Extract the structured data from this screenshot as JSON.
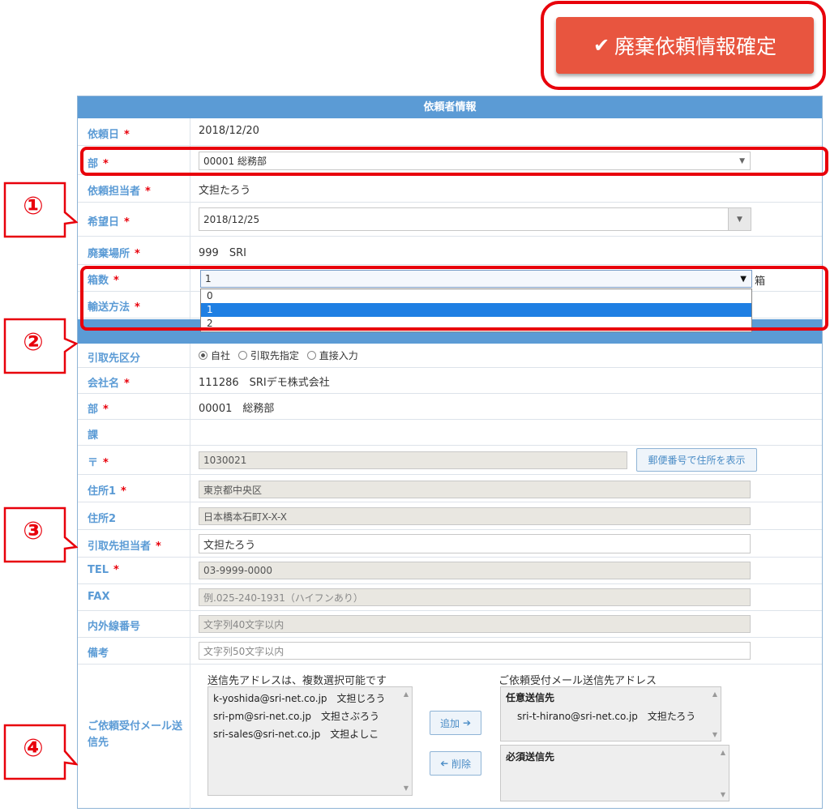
{
  "header": {
    "confirm_label": "廃棄依頼情報確定",
    "check_glyph": "✔"
  },
  "requester_section": {
    "title": "依頼者情報",
    "request_date": {
      "label": "依頼日",
      "value": "2018/12/20"
    },
    "department": {
      "label": "部",
      "value": "00001 総務部"
    },
    "requester": {
      "label": "依頼担当者",
      "value": "文担たろう"
    },
    "desired_date": {
      "label": "希望日",
      "value": "2018/12/25"
    },
    "disposal_location": {
      "label": "廃棄場所",
      "value": "999　SRI"
    },
    "box_count": {
      "label": "箱数",
      "value": "1",
      "unit": "箱",
      "options": [
        "0",
        "1",
        "2"
      ],
      "selected_index": 1
    },
    "transport": {
      "label": "輸送方法"
    }
  },
  "pickup_section": {
    "type": {
      "label": "引取先区分",
      "options": [
        "自社",
        "引取先指定",
        "直接入力"
      ],
      "selected": "自社"
    },
    "company": {
      "label": "会社名",
      "value": "111286　SRIデモ株式会社"
    },
    "department": {
      "label": "部",
      "value": "00001　総務部"
    },
    "section": {
      "label": "課",
      "value": ""
    },
    "postal": {
      "label": "〒",
      "value": "1030021",
      "button": "郵便番号で住所を表示"
    },
    "address1": {
      "label": "住所1",
      "value": "東京都中央区"
    },
    "address2": {
      "label": "住所2",
      "value": "日本橋本石町X-X-X"
    },
    "contact": {
      "label": "引取先担当者",
      "value": "文担たろう"
    },
    "tel": {
      "label": "TEL",
      "value": "03-9999-0000"
    },
    "fax": {
      "label": "FAX",
      "placeholder": "例.025-240-1931（ハイフンあり）"
    },
    "extension": {
      "label": "内外線番号",
      "placeholder": "文字列40文字以内"
    },
    "remarks": {
      "label": "備考",
      "placeholder": "文字列50文字以内"
    }
  },
  "mail": {
    "label": "ご依頼受付メール送信先",
    "source_caption": "送信先アドレスは、複数選択可能です",
    "source_items": [
      "k-yoshida@sri-net.co.jp　文担じろう",
      "sri-pm@sri-net.co.jp　文担さぶろう",
      "sri-sales@sri-net.co.jp　文担よしこ"
    ],
    "add_button": "追加",
    "remove_button": "削除",
    "dest_caption": "ご依頼受付メール送信先アドレス",
    "optional_title": "任意送信先",
    "optional_items": [
      "sri-t-hirano@sri-net.co.jp　文担たろう"
    ],
    "required_title": "必須送信先"
  },
  "callouts": [
    "①",
    "②",
    "③",
    "④"
  ],
  "colors": {
    "accent": "#5b9bd5",
    "annotation_red": "#e8000b",
    "confirm_button": "#e8553f"
  }
}
